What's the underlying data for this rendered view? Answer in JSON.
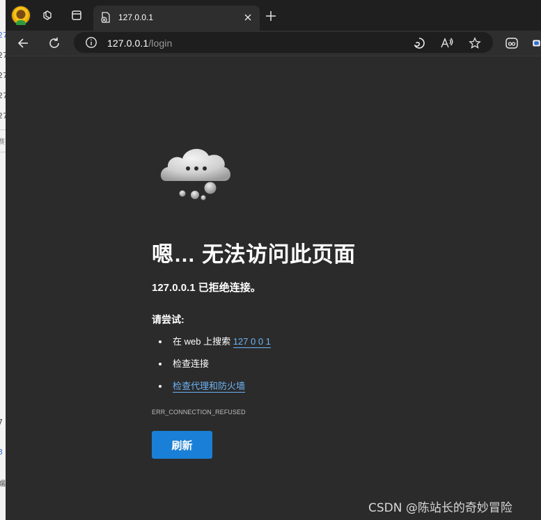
{
  "background_window": {
    "fragments": [
      "27",
      "27",
      "27",
      "27",
      "27",
      "赛",
      "7",
      "3",
      "端"
    ]
  },
  "tabbar": {
    "tab_title": "127.0.0.1",
    "icons": [
      "profile-avatar",
      "workspaces-icon",
      "tab-actions-icon",
      "tab-error-favicon",
      "close-icon",
      "plus-icon"
    ]
  },
  "toolbar": {
    "url_host": "127.0.0.1",
    "url_path": "/login",
    "icons": [
      "back-icon",
      "refresh-icon",
      "info-icon",
      "browser-essentials-icon",
      "read-aloud-icon",
      "favorite-star-icon",
      "extension-icon"
    ]
  },
  "error_page": {
    "heading": "嗯… 无法访问此页面",
    "refused_message": "127.0.0.1 已拒绝连接。",
    "try_label": "请尝试:",
    "suggestions": [
      {
        "prefix": "在 web 上搜索 ",
        "link": "127 0 0 1"
      },
      {
        "text": "检查连接"
      },
      {
        "link": "检查代理和防火墙"
      }
    ],
    "error_code": "ERR_CONNECTION_REFUSED",
    "refresh_label": "刷新"
  },
  "watermark": "CSDN @陈站长的奇妙冒险",
  "colors": {
    "page_bg": "#2b2b2b",
    "tabbar_bg": "#1f1f1f",
    "link": "#6cb4f5",
    "button": "#1a7fd6"
  }
}
